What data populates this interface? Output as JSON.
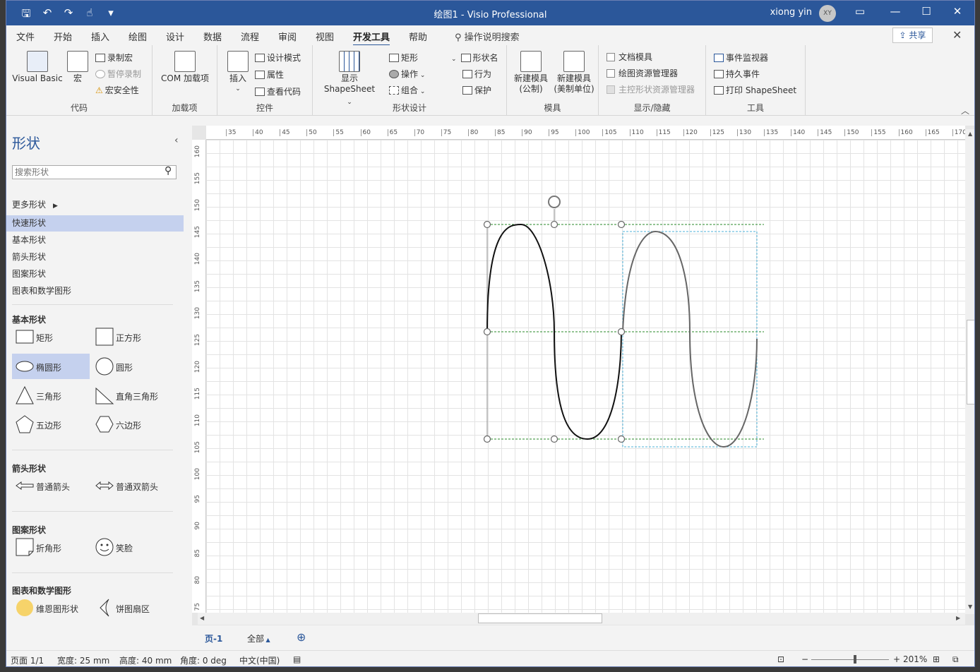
{
  "titlebar": {
    "title": "绘图1  -  Visio Professional",
    "user": "xiong yin",
    "avatar": "XY",
    "qat_icons": [
      "save-icon",
      "undo-icon",
      "redo-icon",
      "touch-icon",
      "customize-icon"
    ]
  },
  "menu": {
    "tabs": [
      "文件",
      "开始",
      "插入",
      "绘图",
      "设计",
      "数据",
      "流程",
      "审阅",
      "视图",
      "开发工具",
      "帮助"
    ],
    "active_tab": "开发工具",
    "tell_me": "操作说明搜索",
    "share": "共享"
  },
  "ribbon": {
    "code": {
      "label": "代码",
      "visual_basic": "Visual Basic",
      "macros": "宏",
      "record_macro": "录制宏",
      "pause_recording": "暂停录制",
      "macro_security": "宏安全性"
    },
    "addins": {
      "label": "加载项",
      "com_addins": "COM 加载项"
    },
    "controls": {
      "label": "控件",
      "insert": "插入",
      "design_mode": "设计模式",
      "properties": "属性",
      "view_code": "查看代码"
    },
    "shape_design": {
      "label": "形状设计",
      "show_shapesheet_1": "显示",
      "show_shapesheet_2": "ShapeSheet",
      "rectangle": "矩形",
      "operations": "操作",
      "group": "组合",
      "shape_name": "形状名",
      "behavior": "行为",
      "protection": "保护"
    },
    "stencil": {
      "label": "模具",
      "new_metric_1": "新建模具",
      "new_metric_2": "(公制)",
      "new_us_1": "新建模具",
      "new_us_2": "(美制单位)"
    },
    "show_hide": {
      "label": "显示/隐藏",
      "document_stencil": "文档模具",
      "drawing_explorer": "绘图资源管理器",
      "master_explorer": "主控形状资源管理器"
    },
    "tools": {
      "label": "工具",
      "event_monitor": "事件监视器",
      "persistent_events": "持久事件",
      "print_shapesheet": "打印 ShapeSheet"
    }
  },
  "shapes_panel": {
    "title": "形状",
    "search_placeholder": "搜索形状",
    "more_shapes": "更多形状",
    "nav": [
      "快速形状",
      "基本形状",
      "箭头形状",
      "图案形状",
      "图表和数学图形"
    ],
    "selected_nav": "快速形状",
    "sections": [
      {
        "title": "基本形状",
        "items": [
          "矩形",
          "正方形",
          "椭圆形",
          "圆形",
          "三角形",
          "直角三角形",
          "五边形",
          "六边形"
        ]
      },
      {
        "title": "箭头形状",
        "items": [
          "普通箭头",
          "普通双箭头"
        ]
      },
      {
        "title": "图案形状",
        "items": [
          "折角形",
          "笑脸"
        ]
      },
      {
        "title": "图表和数学图形",
        "items": [
          "维恩图形状",
          "饼图扇区"
        ]
      }
    ],
    "selected_shape": "椭圆形"
  },
  "rulers": {
    "horizontal": [
      "35",
      "40",
      "45",
      "50",
      "55",
      "60",
      "65",
      "70",
      "75",
      "80",
      "85",
      "90",
      "95",
      "100",
      "105",
      "110",
      "115",
      "120",
      "125",
      "130",
      "135",
      "140",
      "145",
      "150",
      "155",
      "160",
      "165",
      "170"
    ],
    "vertical": [
      "160",
      "155",
      "150",
      "145",
      "140",
      "135",
      "130",
      "125",
      "120",
      "115",
      "110",
      "105",
      "100",
      "95",
      "90",
      "85",
      "80",
      "75"
    ]
  },
  "page_tabs": {
    "current": "页-1",
    "all": "全部"
  },
  "status": {
    "page": "页面 1/1",
    "width": "宽度: 25 mm",
    "height": "高度: 40 mm",
    "angle": "角度: 0 deg",
    "language": "中文(中国)",
    "zoom": "201%"
  }
}
